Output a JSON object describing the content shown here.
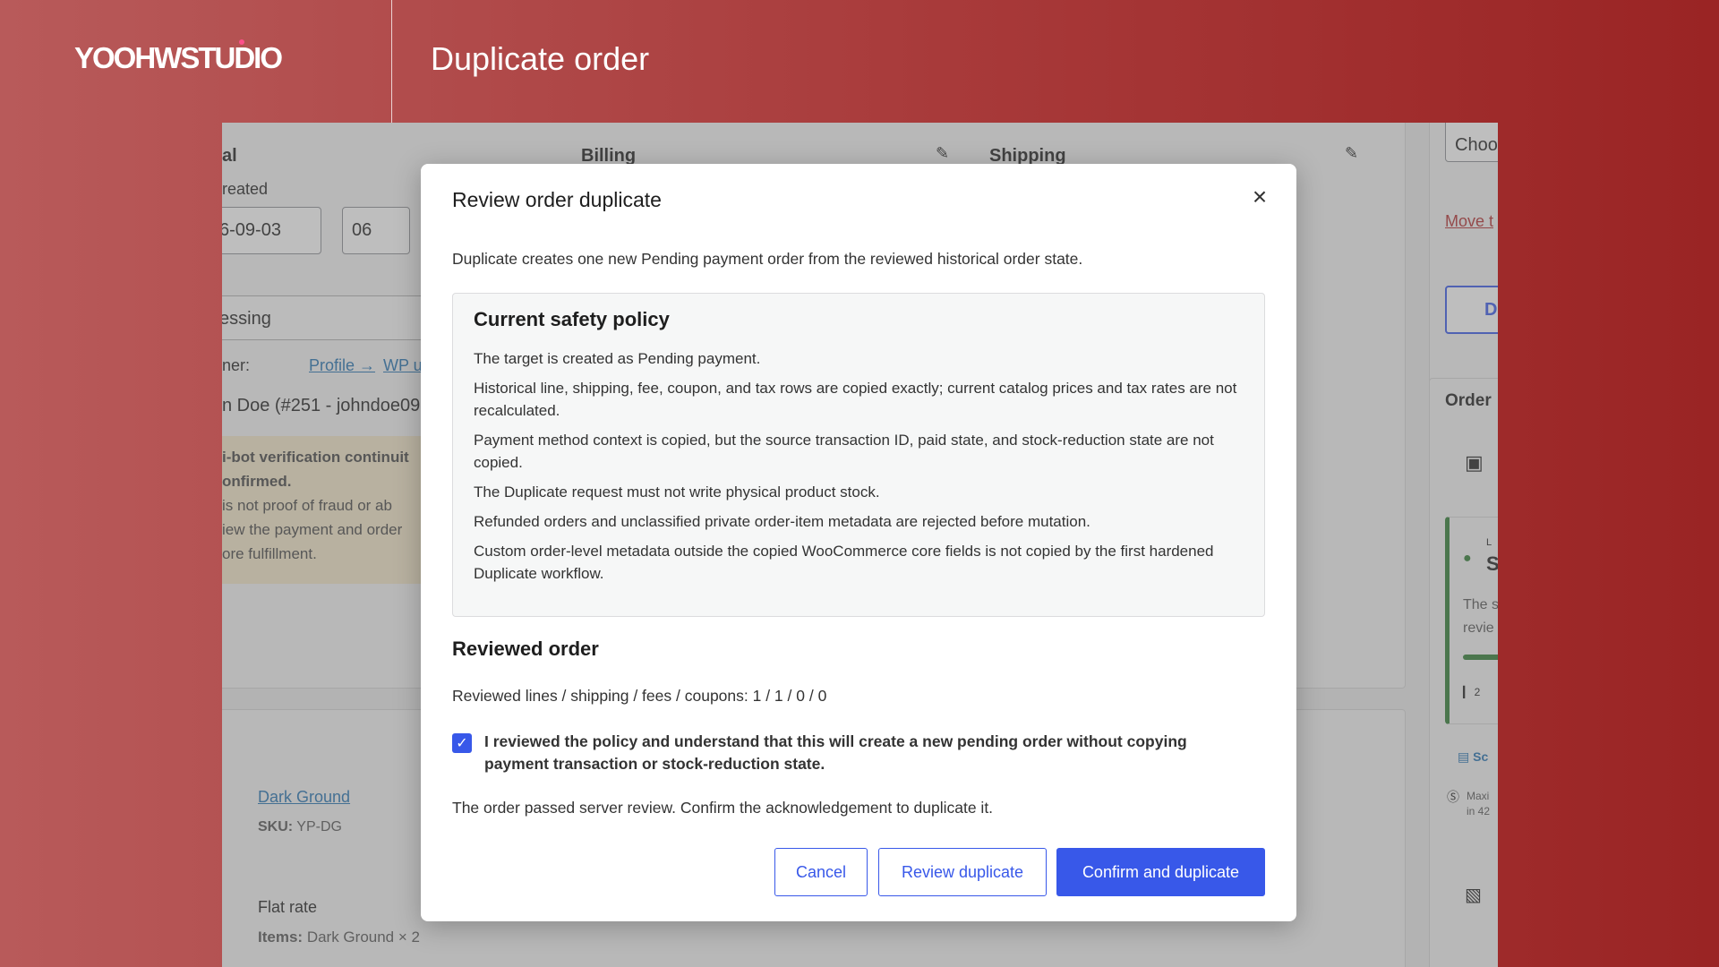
{
  "header": {
    "brand": "YOOHWSTUDIO",
    "title": "Duplicate order"
  },
  "background": {
    "col1_heading": "al",
    "billing_heading": "Billing",
    "shipping_heading": "Shipping",
    "date_created_label": "reated",
    "date_value": "6-09-03",
    "hour_value": "06",
    "status_value": "essing",
    "customer_label": "ner:",
    "profile_link": "Profile →",
    "wp_link": "WP u",
    "customer_value": "n Doe (#251 - johndoe09",
    "notice_line1": "i-bot verification continuit",
    "notice_line2": "onfirmed.",
    "notice_line3": "is not proof of fraud or ab",
    "notice_line4": "iew the payment and order",
    "notice_line5": "ore fulfillment.",
    "product_name": "Dark Ground",
    "sku_label": "SKU:",
    "sku_value": "YP-DG",
    "shipping_method": "Flat rate",
    "items_label": "Items:",
    "items_value": "Dark Ground × 2",
    "right_select": "Choo",
    "right_link": "Move t",
    "right_button": "D",
    "right_heading": "Order",
    "right_small1": "L",
    "right_big": "S",
    "right_text1": "The s",
    "right_text2": "revie",
    "right_stat": "2",
    "right_sc": "Sc",
    "right_max": "Maxi",
    "right_in": "in 42"
  },
  "modal": {
    "title": "Review order duplicate",
    "close_label": "×",
    "intro": "Duplicate creates one new Pending payment order from the reviewed historical order state.",
    "policy": {
      "heading": "Current safety policy",
      "items": [
        "The target is created as Pending payment.",
        "Historical line, shipping, fee, coupon, and tax rows are copied exactly; current catalog prices and tax rates are not recalculated.",
        "Payment method context is copied, but the source transaction ID, paid state, and stock-reduction state are not copied.",
        "The Duplicate request must not write physical product stock.",
        "Refunded orders and unclassified private order-item metadata are rejected before mutation.",
        "Custom order-level metadata outside the copied WooCommerce core fields is not copied by the first hardened Duplicate workflow."
      ]
    },
    "reviewed_heading": "Reviewed order",
    "counts": "Reviewed lines / shipping / fees / coupons: 1 / 1 / 0 / 0",
    "ack_checked": true,
    "ack_text": "I reviewed the policy and understand that this will create a new pending order without copying payment transaction or stock-reduction state.",
    "status": "The order passed server review. Confirm the acknowledgement to duplicate it.",
    "buttons": {
      "cancel": "Cancel",
      "review": "Review duplicate",
      "confirm": "Confirm and duplicate"
    }
  },
  "colors": {
    "accent": "#3858e9",
    "background_gradient_start": "#b85a5a",
    "background_gradient_end": "#9a2424"
  }
}
